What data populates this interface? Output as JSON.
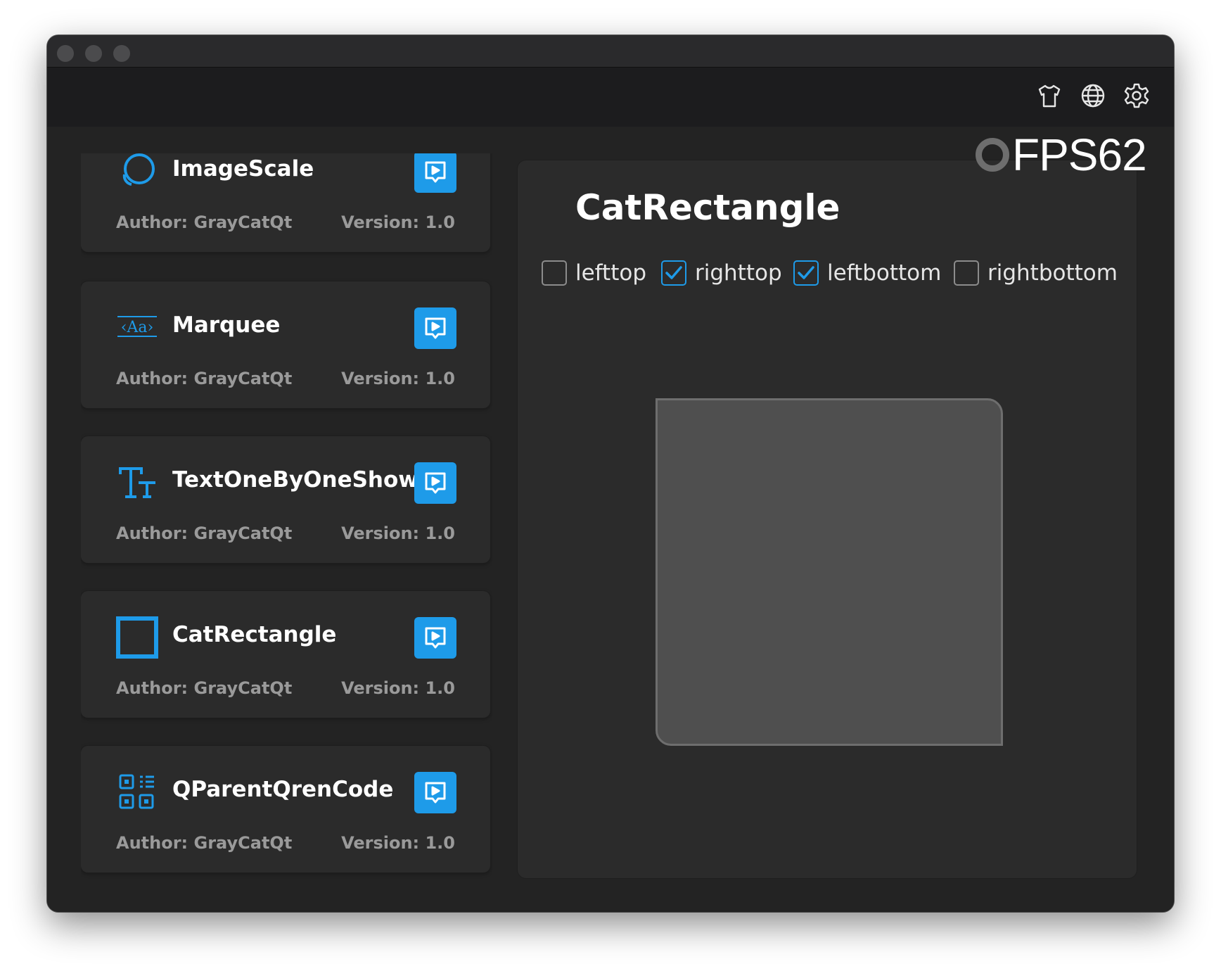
{
  "colors": {
    "accent": "#1e9be9",
    "window_bg": "#1c1c1e",
    "card_bg": "#2b2b2b",
    "muted_text": "#9a9a9a"
  },
  "toolbar": {
    "icons": [
      "theme-shirt-icon",
      "language-globe-icon",
      "settings-gear-icon"
    ]
  },
  "fps": {
    "label": "FPS62"
  },
  "components": [
    {
      "title": "ImageScale",
      "icon": "image-scale-icon",
      "author": "Author: GrayCatQt",
      "version": "Version: 1.0"
    },
    {
      "title": "Marquee",
      "icon": "marquee-icon",
      "author": "Author: GrayCatQt",
      "version": "Version: 1.0"
    },
    {
      "title": "TextOneByOneShow",
      "icon": "text-icon",
      "author": "Author: GrayCatQt",
      "version": "Version: 1.0"
    },
    {
      "title": "CatRectangle",
      "icon": "rectangle-icon",
      "author": "Author: GrayCatQt",
      "version": "Version: 1.0"
    },
    {
      "title": "QParentQrenCode",
      "icon": "qrcode-icon",
      "author": "Author: GrayCatQt",
      "version": "Version: 1.0"
    }
  ],
  "panel": {
    "title": "CatRectangle",
    "marquee_icon_text": "‹Aa›",
    "options": [
      {
        "label": "lefttop",
        "checked": false
      },
      {
        "label": "righttop",
        "checked": true
      },
      {
        "label": "leftbottom",
        "checked": true
      },
      {
        "label": "rightbottom",
        "checked": false
      }
    ]
  }
}
